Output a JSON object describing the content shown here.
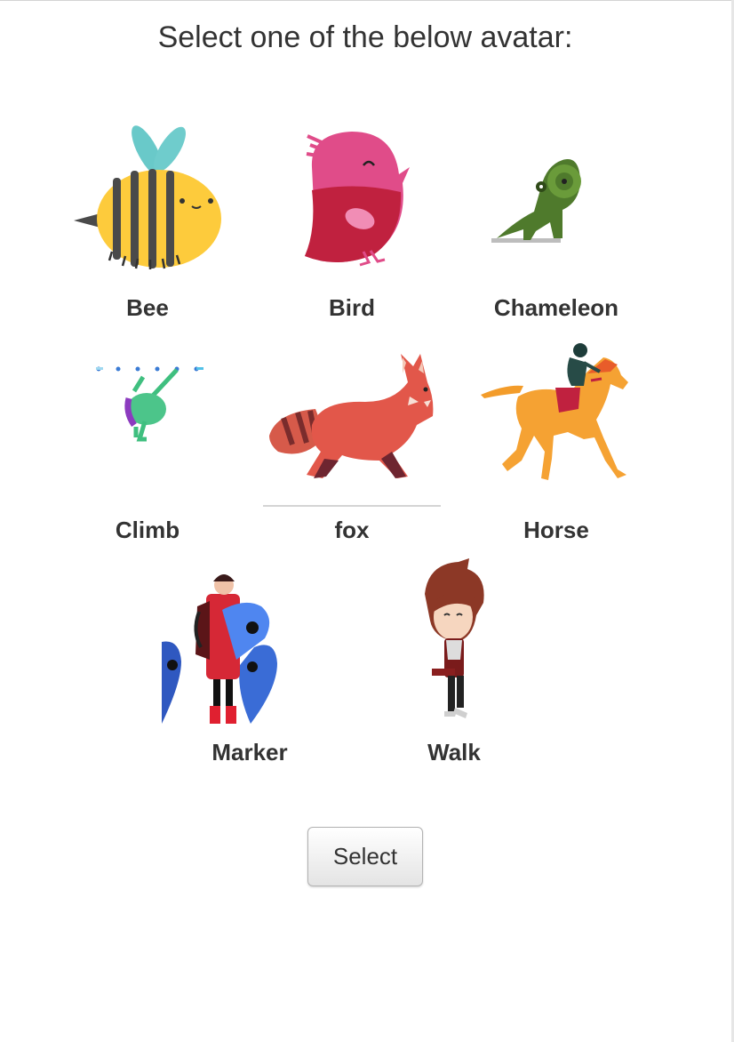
{
  "heading": "Select one of the below avatar:",
  "avatars": [
    {
      "label": "Bee"
    },
    {
      "label": "Bird"
    },
    {
      "label": "Chameleon"
    },
    {
      "label": "Climb"
    },
    {
      "label": "fox"
    },
    {
      "label": "Horse"
    },
    {
      "label": "Marker"
    },
    {
      "label": "Walk"
    }
  ],
  "select_button": {
    "label": "Select"
  }
}
